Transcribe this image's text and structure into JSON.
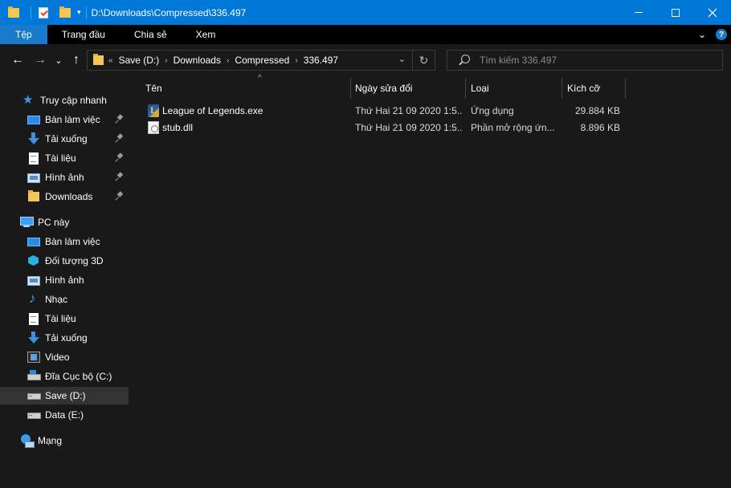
{
  "window": {
    "title": "D:\\Downloads\\Compressed\\336.497",
    "quick_access_dropdown": "▾"
  },
  "ribbon": {
    "tabs": [
      {
        "label": "Tệp"
      },
      {
        "label": "Trang đầu"
      },
      {
        "label": "Chia sẻ"
      },
      {
        "label": "Xem"
      }
    ],
    "expand_glyph": "⌄",
    "help_glyph": "?"
  },
  "nav": {
    "back": "←",
    "forward": "→",
    "recent": "⌄",
    "up": "↑"
  },
  "address": {
    "lead": "«",
    "crumbs": [
      {
        "label": "Save (D:)"
      },
      {
        "label": "Downloads"
      },
      {
        "label": "Compressed"
      },
      {
        "label": "336.497"
      }
    ],
    "separator": "›",
    "dropdown": "⌄",
    "refresh": "↻"
  },
  "search": {
    "placeholder": "Tìm kiếm 336.497",
    "value": ""
  },
  "sidebar": {
    "quick_access": {
      "label": "Truy cập nhanh",
      "items": [
        {
          "label": "Bàn làm việc",
          "pinned": true
        },
        {
          "label": "Tải xuống",
          "pinned": true
        },
        {
          "label": "Tài liệu",
          "pinned": true
        },
        {
          "label": "Hình ảnh",
          "pinned": true
        },
        {
          "label": "Downloads",
          "pinned": true
        }
      ]
    },
    "this_pc": {
      "label": "PC này",
      "items": [
        {
          "label": "Bàn làm việc"
        },
        {
          "label": "Đối tượng 3D"
        },
        {
          "label": "Hình ảnh"
        },
        {
          "label": "Nhạc"
        },
        {
          "label": "Tài liệu"
        },
        {
          "label": "Tải xuống"
        },
        {
          "label": "Video"
        },
        {
          "label": "Đĩa Cục bộ (C:)"
        },
        {
          "label": "Save (D:)",
          "selected": true
        },
        {
          "label": "Data (E:)"
        }
      ]
    },
    "network": {
      "label": "Mạng"
    }
  },
  "file_list": {
    "sort_indicator": "^",
    "columns": [
      {
        "label": "Tên"
      },
      {
        "label": "Ngày sửa đổi"
      },
      {
        "label": "Loại"
      },
      {
        "label": "Kích cỡ"
      }
    ],
    "rows": [
      {
        "name": "League of Legends.exe",
        "modified": "Thứ Hai 21 09 2020 1:5...",
        "type": "Ứng dụng",
        "size": "29.884 KB",
        "icon": "exe-icon"
      },
      {
        "name": "stub.dll",
        "modified": "Thứ Hai 21 09 2020 1:5...",
        "type": "Phần mở rộng ứn...",
        "size": "8.896 KB",
        "icon": "dll-icon"
      }
    ]
  },
  "colors": {
    "title_bar": "#0078d7",
    "active_tab": "#1979ca",
    "background": "#191919",
    "selected_item": "#333333"
  }
}
